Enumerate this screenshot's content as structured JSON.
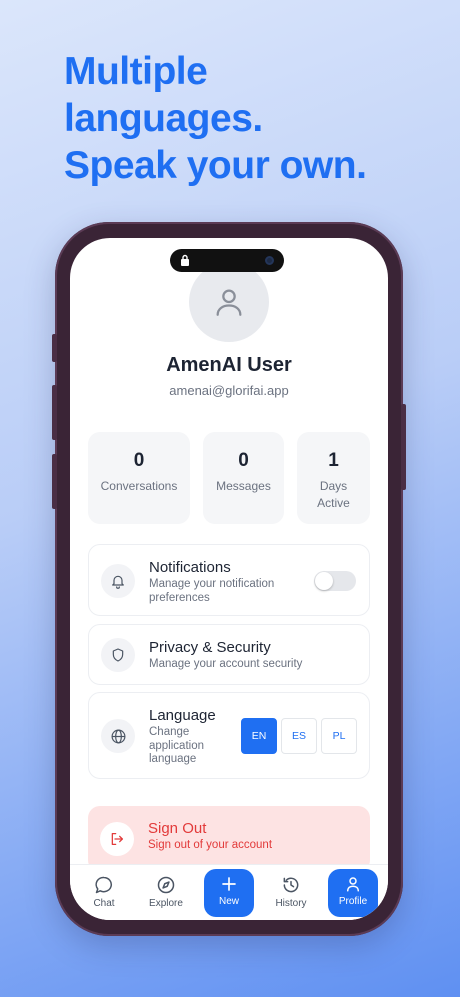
{
  "headline": {
    "line1": "Multiple",
    "line2": "languages.",
    "line3": "Speak your own."
  },
  "profile": {
    "name": "AmenAI User",
    "email": "amenai@glorifai.app"
  },
  "stats": [
    {
      "value": "0",
      "label": "Conversations"
    },
    {
      "value": "0",
      "label": "Messages"
    },
    {
      "value": "1",
      "label_line1": "Days",
      "label_line2": "Active"
    }
  ],
  "settings": {
    "notifications": {
      "title": "Notifications",
      "subtitle_line1": "Manage your notification",
      "subtitle_line2": "preferences",
      "enabled": false,
      "icon": "bell-icon"
    },
    "privacy": {
      "title": "Privacy & Security",
      "subtitle": "Manage your account security",
      "icon": "shield-icon"
    },
    "language": {
      "title": "Language",
      "subtitle_line1": "Change",
      "subtitle_line2": "application",
      "subtitle_line3": "language",
      "icon": "globe-icon",
      "options": [
        "EN",
        "ES",
        "PL"
      ],
      "selected": "EN"
    }
  },
  "signout": {
    "title": "Sign Out",
    "subtitle": "Sign out of your account",
    "icon": "logout-icon"
  },
  "tabs": [
    {
      "label": "Chat",
      "icon": "chat-bubble-icon"
    },
    {
      "label": "Explore",
      "icon": "compass-icon"
    },
    {
      "label": "New",
      "icon": "plus-icon"
    },
    {
      "label": "History",
      "icon": "history-icon"
    },
    {
      "label": "Profile",
      "icon": "user-icon"
    }
  ],
  "colors": {
    "accent": "#1f6ff2",
    "danger": "#e23a3a",
    "danger_bg": "#fde3e3"
  }
}
